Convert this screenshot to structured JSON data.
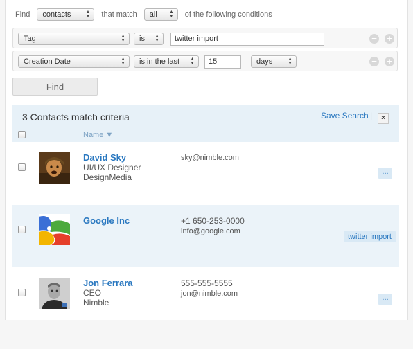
{
  "find_bar": {
    "find_label": "Find",
    "entity_value": "contacts",
    "match_label": "that match",
    "match_value": "all",
    "suffix_label": "of the following conditions"
  },
  "conditions": [
    {
      "field": "Tag",
      "operator": "is",
      "value": "twitter import"
    },
    {
      "field": "Creation Date",
      "operator": "is in the last",
      "value": "15",
      "unit": "days"
    }
  ],
  "find_button": "Find",
  "results": {
    "count_text": "3 Contacts match criteria",
    "save_search": "Save Search",
    "divider": "|",
    "close": "×",
    "name_header": "Name ▼"
  },
  "contacts": [
    {
      "name": "David Sky",
      "line1": "UI/UX Designer",
      "line2": "DesignMedia",
      "info1": "sky@nimble.com",
      "info2": "",
      "more": "...",
      "avatar_icon": "person-photo-icon"
    },
    {
      "name": "Google Inc",
      "line1": "",
      "line2": "",
      "info1": "+1 650-253-0000",
      "info2": "info@google.com",
      "tag": "twitter import",
      "avatar_icon": "google-logo-icon"
    },
    {
      "name": "Jon Ferrara",
      "line1": "CEO",
      "line2": "Nimble",
      "info1": "555-555-5555",
      "info2": "jon@nimble.com",
      "more": "...",
      "avatar_icon": "person-photo-icon"
    }
  ],
  "colors": {
    "accent": "#2a78c0",
    "highlight": "#e7f1f8"
  }
}
